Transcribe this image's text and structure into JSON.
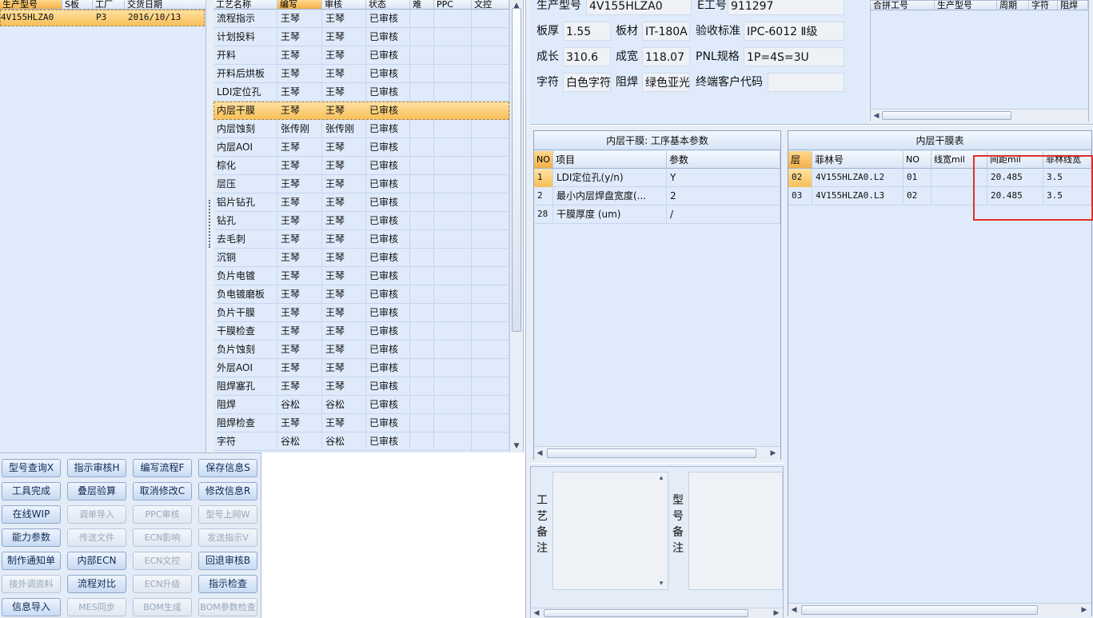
{
  "model_list": {
    "headers": [
      "生产型号",
      "S板",
      "工厂",
      "交货日期"
    ],
    "rows": [
      [
        "4V155HLZA0",
        "P3",
        "2016/10/13"
      ]
    ]
  },
  "process_list": {
    "headers": [
      "工艺名称",
      "编写",
      "审核",
      "状态",
      "难",
      "PPC",
      "文控"
    ],
    "rows": [
      [
        "流程指示",
        "王琴",
        "王琴",
        "已审核"
      ],
      [
        "计划投料",
        "王琴",
        "王琴",
        "已审核"
      ],
      [
        "开料",
        "王琴",
        "王琴",
        "已审核"
      ],
      [
        "开料后烘板",
        "王琴",
        "王琴",
        "已审核"
      ],
      [
        "LDI定位孔",
        "王琴",
        "王琴",
        "已审核"
      ],
      [
        "内层干膜",
        "王琴",
        "王琴",
        "已审核"
      ],
      [
        "内层蚀刻",
        "张传刚",
        "张传刚",
        "已审核"
      ],
      [
        "内层AOI",
        "王琴",
        "王琴",
        "已审核"
      ],
      [
        "棕化",
        "王琴",
        "王琴",
        "已审核"
      ],
      [
        "层压",
        "王琴",
        "王琴",
        "已审核"
      ],
      [
        "铝片钻孔",
        "王琴",
        "王琴",
        "已审核"
      ],
      [
        "钻孔",
        "王琴",
        "王琴",
        "已审核"
      ],
      [
        "去毛刺",
        "王琴",
        "王琴",
        "已审核"
      ],
      [
        "沉铜",
        "王琴",
        "王琴",
        "已审核"
      ],
      [
        "负片电镀",
        "王琴",
        "王琴",
        "已审核"
      ],
      [
        "负电镀磨板",
        "王琴",
        "王琴",
        "已审核"
      ],
      [
        "负片干膜",
        "王琴",
        "王琴",
        "已审核"
      ],
      [
        "干膜检查",
        "王琴",
        "王琴",
        "已审核"
      ],
      [
        "负片蚀刻",
        "王琴",
        "王琴",
        "已审核"
      ],
      [
        "外层AOI",
        "王琴",
        "王琴",
        "已审核"
      ],
      [
        "阻焊塞孔",
        "王琴",
        "王琴",
        "已审核"
      ],
      [
        "阻焊",
        "谷松",
        "谷松",
        "已审核"
      ],
      [
        "阻焊检查",
        "王琴",
        "王琴",
        "已审核"
      ],
      [
        "字符",
        "谷松",
        "谷松",
        "已审核"
      ]
    ]
  },
  "buttons": [
    {
      "label": "型号查询X",
      "enabled": true
    },
    {
      "label": "指示审核H",
      "enabled": true
    },
    {
      "label": "编写流程F",
      "enabled": true
    },
    {
      "label": "保存信息S",
      "enabled": true
    },
    {
      "label": "工具完成",
      "enabled": true
    },
    {
      "label": "叠层验算",
      "enabled": true
    },
    {
      "label": "取消修改C",
      "enabled": true
    },
    {
      "label": "修改信息R",
      "enabled": true
    },
    {
      "label": "在线WIP",
      "enabled": true
    },
    {
      "label": "调单导入",
      "enabled": false
    },
    {
      "label": "PPC审核",
      "enabled": false
    },
    {
      "label": "型号上网W",
      "enabled": false
    },
    {
      "label": "能力参数",
      "enabled": true
    },
    {
      "label": "传送文件",
      "enabled": false
    },
    {
      "label": "ECN影响",
      "enabled": false
    },
    {
      "label": "发送指示V",
      "enabled": false
    },
    {
      "label": "制作通知单",
      "enabled": true
    },
    {
      "label": "内部ECN",
      "enabled": true
    },
    {
      "label": "ECN文控",
      "enabled": false
    },
    {
      "label": "回退审核B",
      "enabled": true
    },
    {
      "label": "接外调资料",
      "enabled": false
    },
    {
      "label": "流程对比",
      "enabled": true
    },
    {
      "label": "ECN升级",
      "enabled": false
    },
    {
      "label": "指示检查",
      "enabled": true
    },
    {
      "label": "信息导入",
      "enabled": true
    },
    {
      "label": "MES同步",
      "enabled": false
    },
    {
      "label": "BOM生成",
      "enabled": false
    },
    {
      "label": "BOM参数检查",
      "enabled": false
    }
  ],
  "info": {
    "model_label": "生产型号",
    "model_value": "4V155HLZA0",
    "e_label": "E工号",
    "e_value": "911297",
    "thickness_label": "板厚",
    "thickness_value": "1.55",
    "material_label": "板材",
    "material_value": "IT-180A",
    "standard_label": "验收标准",
    "standard_value": "IPC-6012 Ⅱ级",
    "length_label": "成长",
    "length_value": "310.6",
    "width_label": "成宽",
    "width_value": "118.07",
    "pnl_label": "PNL规格",
    "pnl_value": "1P=4S=3U",
    "char_label": "字符",
    "char_value": "白色字符",
    "mask_label": "阻焊",
    "mask_value": "绿色亚光",
    "customer_label": "终端客户代码",
    "customer_value": ""
  },
  "merge_table": {
    "headers": [
      "合拼工号",
      "生产型号",
      "周期",
      "字符",
      "阻焊"
    ]
  },
  "params_table": {
    "title": "内层干膜: 工序基本参数",
    "headers": [
      "NO",
      "项目",
      "参数"
    ],
    "rows": [
      [
        "1",
        "LDI定位孔(y/n)",
        "Y"
      ],
      [
        "2",
        "最小内层焊盘宽度(...",
        "2"
      ],
      [
        "28",
        "干膜厚度 (um)",
        "/"
      ]
    ]
  },
  "film_table": {
    "title": "内层干膜表",
    "headers": [
      "层",
      "菲林号",
      "NO",
      "线宽mil",
      "间距mil",
      "菲林线宽"
    ],
    "rows": [
      [
        "02",
        "4V155HLZA0.L2",
        "01",
        "",
        "20.485",
        "3.5"
      ],
      [
        "03",
        "4V155HLZA0.L3",
        "02",
        "",
        "20.485",
        "3.5"
      ]
    ]
  },
  "remarks": {
    "process_label": "工艺备注",
    "model_label": "型号备注"
  },
  "colors": {
    "panel": "#dfebfb",
    "selection": "#f8bf58",
    "highlight_box": "#e0302a"
  }
}
